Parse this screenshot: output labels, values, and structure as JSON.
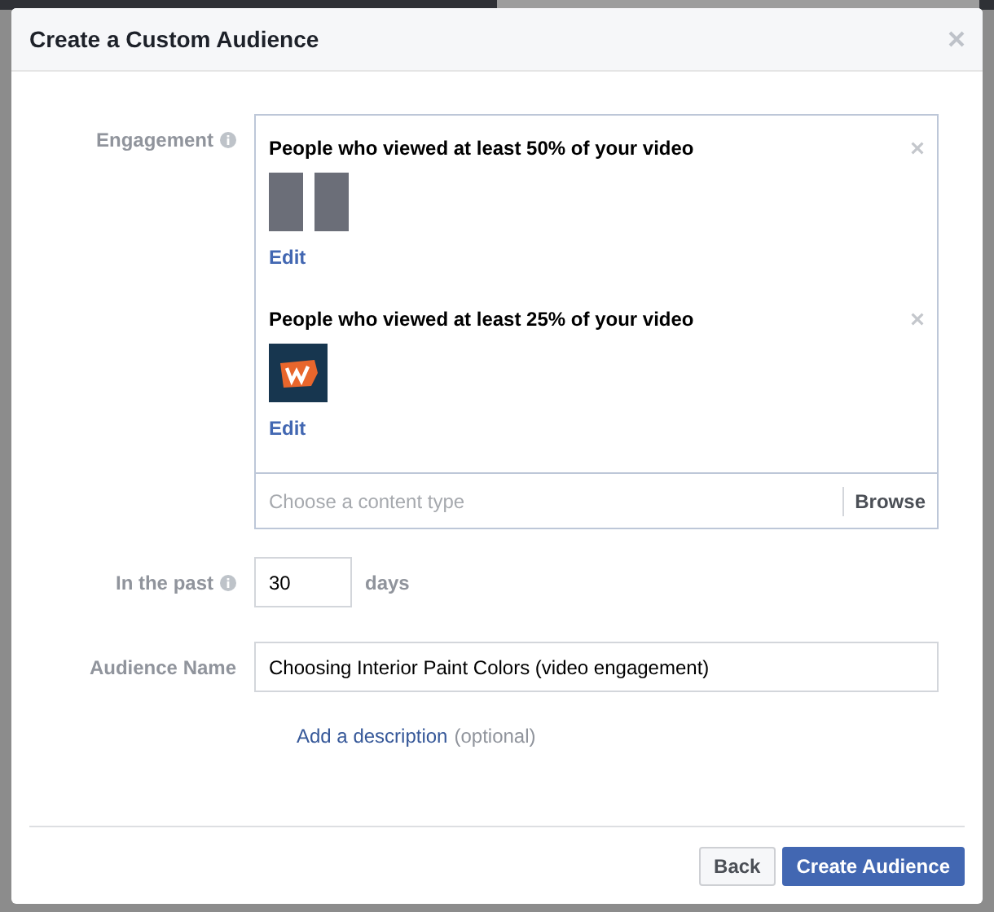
{
  "dialog": {
    "title": "Create a Custom Audience"
  },
  "engagement": {
    "label": "Engagement",
    "rules": [
      {
        "title": "People who viewed at least 50% of your video",
        "thumbnails": [
          {
            "kind": "photo"
          },
          {
            "kind": "photo"
          }
        ],
        "edit": "Edit"
      },
      {
        "title": "People who viewed at least 25% of your video",
        "thumbnails": [
          {
            "kind": "logo"
          }
        ],
        "edit": "Edit"
      }
    ],
    "placeholder": "Choose a content type",
    "browse": "Browse"
  },
  "past": {
    "label": "In the past",
    "value": "30",
    "unit": "days"
  },
  "audience_name": {
    "label": "Audience Name",
    "value": "Choosing Interior Paint Colors (video engagement)"
  },
  "description": {
    "link": "Add a description",
    "note": "(optional)"
  },
  "buttons": [
    {
      "label": "Back",
      "kind": "secondary"
    },
    {
      "label": "Create Audience",
      "kind": "primary"
    }
  ]
}
